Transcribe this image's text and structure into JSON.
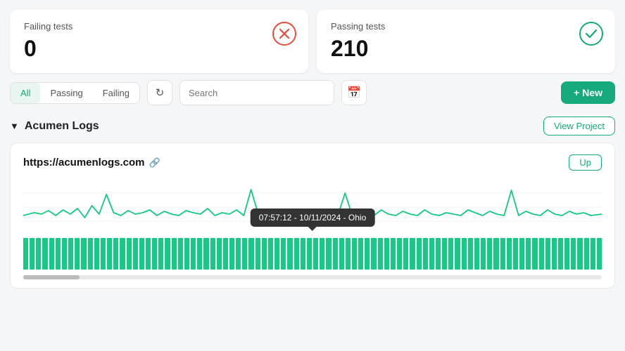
{
  "cards": {
    "failing": {
      "title": "Failing tests",
      "value": "0",
      "icon_type": "error"
    },
    "passing": {
      "title": "Passing tests",
      "value": "210",
      "icon_type": "success"
    }
  },
  "toolbar": {
    "filters": [
      {
        "label": "All",
        "active": true
      },
      {
        "label": "Passing",
        "active": false
      },
      {
        "label": "Failing",
        "active": false
      }
    ],
    "search_placeholder": "Search",
    "new_label": "+ New"
  },
  "project": {
    "title": "Acumen Logs",
    "view_btn": "View Project"
  },
  "monitor": {
    "url": "https://acumenlogs.com",
    "status": "Up",
    "tooltip": "07:57:12 - 10/11/2024 - Ohio"
  }
}
